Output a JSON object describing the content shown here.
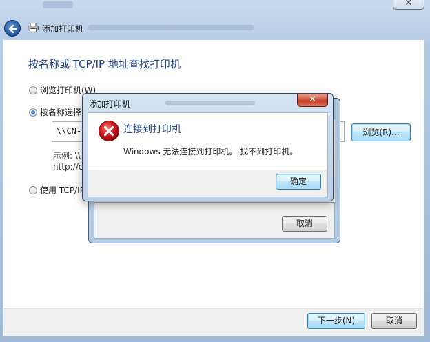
{
  "wizard": {
    "title": "添加打印机",
    "heading": "按名称或 TCP/IP 地址查找打印机",
    "options": [
      {
        "label": "浏览打印机(W)",
        "selected": false
      },
      {
        "label": "按名称选择",
        "selected": true
      },
      {
        "label": "使用 TCP/IP",
        "selected": false
      }
    ],
    "path_value": "\\\\CN-2",
    "example_line1": "示例: \\\\",
    "example_line2": "http://c",
    "browse_label": "浏览(R)...",
    "next_label": "下一步(N)",
    "cancel_label": "取消",
    "close_icon": "close-icon",
    "back_icon": "back-arrow-icon",
    "printer_icon": "printer-icon"
  },
  "back_dialog": {
    "cancel_label": "取消"
  },
  "error_dialog": {
    "title": "添加打印机",
    "close_glyph": "✕",
    "heading": "连接到打印机",
    "message": "Windows 无法连接到打印机。 找不到打印机。",
    "ok_label": "确定",
    "icon": "error-icon",
    "icon_color": "#d0161b"
  }
}
